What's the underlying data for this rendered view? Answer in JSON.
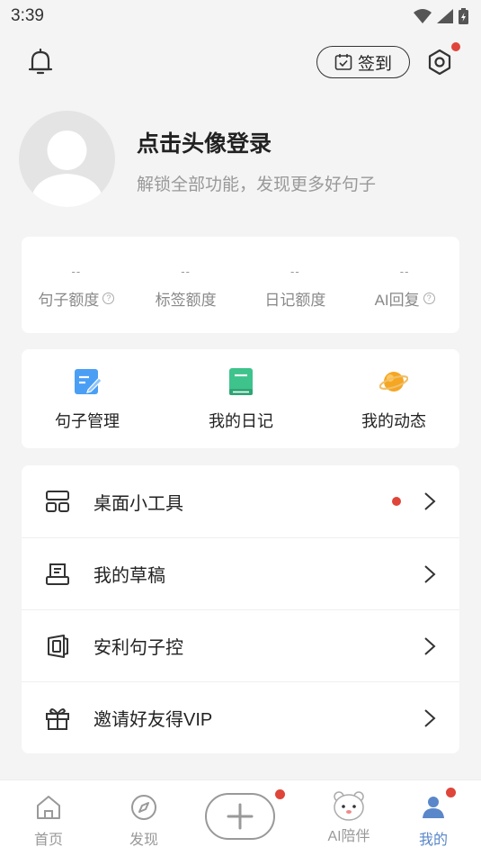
{
  "status_bar": {
    "time": "3:39"
  },
  "header": {
    "checkin_label": "签到"
  },
  "profile": {
    "title": "点击头像登录",
    "subtitle": "解锁全部功能，发现更多好句子"
  },
  "stats": [
    {
      "value": "--",
      "label": "句子额度",
      "has_help": true
    },
    {
      "value": "--",
      "label": "标签额度",
      "has_help": false
    },
    {
      "value": "--",
      "label": "日记额度",
      "has_help": false
    },
    {
      "value": "--",
      "label": "AI回复",
      "has_help": true
    }
  ],
  "shortcuts": [
    {
      "label": "句子管理",
      "icon": "edit-note-icon",
      "color": "#4a9ff5"
    },
    {
      "label": "我的日记",
      "icon": "diary-book-icon",
      "color": "#3ec38c"
    },
    {
      "label": "我的动态",
      "icon": "planet-icon",
      "color": "#f5a623"
    }
  ],
  "menu": [
    {
      "label": "桌面小工具",
      "icon": "widget-grid-icon",
      "badge": true
    },
    {
      "label": "我的草稿",
      "icon": "draft-icon",
      "badge": false
    },
    {
      "label": "安利句子控",
      "icon": "share-app-icon",
      "badge": false
    },
    {
      "label": "邀请好友得VIP",
      "icon": "gift-icon",
      "badge": false
    }
  ],
  "tabbar": [
    {
      "label": "首页",
      "icon": "home-icon"
    },
    {
      "label": "发现",
      "icon": "compass-icon"
    },
    {
      "label": "",
      "icon": "plus-icon"
    },
    {
      "label": "AI陪伴",
      "icon": "ai-bear-icon"
    },
    {
      "label": "我的",
      "icon": "profile-icon"
    }
  ],
  "colors": {
    "badge_red": "#e0453a",
    "background": "#f4f4f4"
  }
}
